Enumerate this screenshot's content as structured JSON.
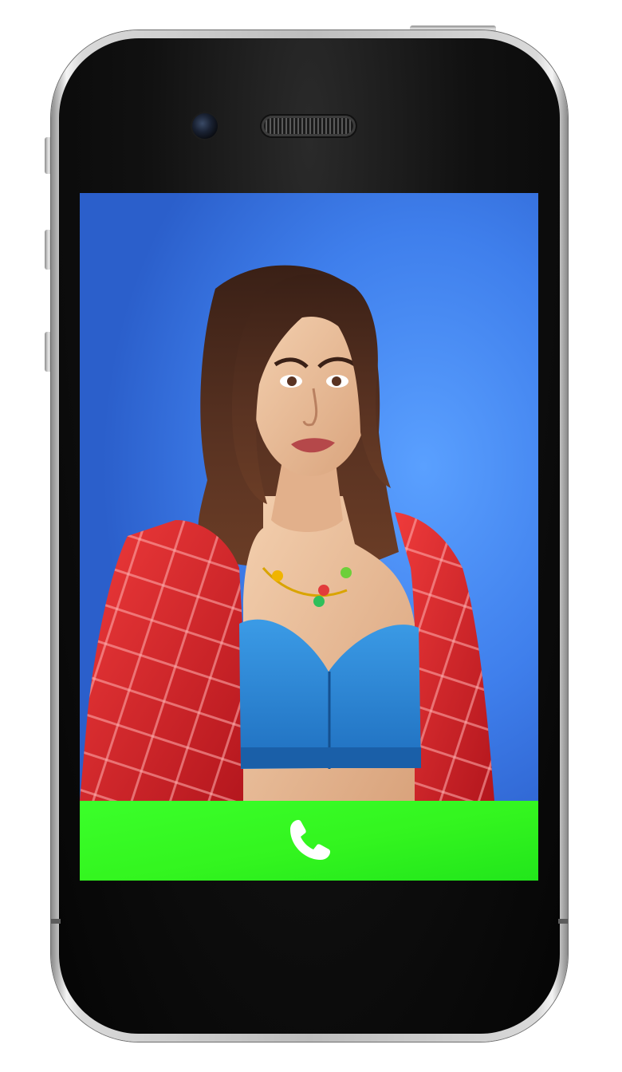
{
  "screen": {
    "background_color": "#3b78e8",
    "caller_portrait": "character-portrait",
    "caller_hair_color": "#4a2a1a",
    "caller_jacket_color": "#d9262c",
    "caller_top_color": "#2f86d6"
  },
  "call_bar": {
    "background_color": "#33f51f",
    "icon": "phone-answer-icon",
    "icon_color": "#ffffff"
  }
}
